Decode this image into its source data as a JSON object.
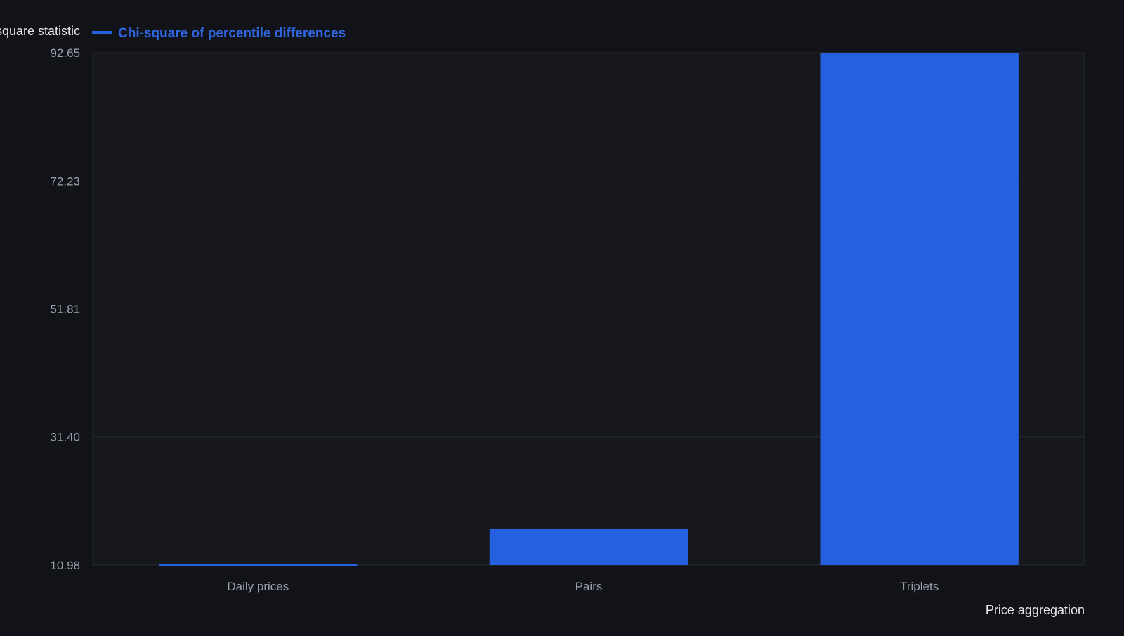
{
  "chart_data": {
    "type": "bar",
    "title": "",
    "ylabel": "Chi-square statistic",
    "xlabel": "Price aggregation",
    "categories": [
      "Daily prices",
      "Pairs",
      "Triplets"
    ],
    "series": [
      {
        "name": "Chi-square of percentile differences",
        "values": [
          10.98,
          16.7,
          92.65
        ]
      }
    ],
    "ylim": [
      10.98,
      92.65
    ],
    "yticks": [
      "92.65",
      "72.23",
      "51.81",
      "31.40",
      "10.98"
    ],
    "ytick_values": [
      92.65,
      72.23,
      51.81,
      31.4,
      10.98
    ],
    "grid": true,
    "legend_position": "top-left",
    "colors": {
      "background": "#111318",
      "plot_background": "#16181d",
      "bar": "#2560de",
      "legend_text": "#2f66e0",
      "grid": "#272a31",
      "axis_text": "#9aa0a8",
      "label_text": "#e6e8eb"
    }
  }
}
